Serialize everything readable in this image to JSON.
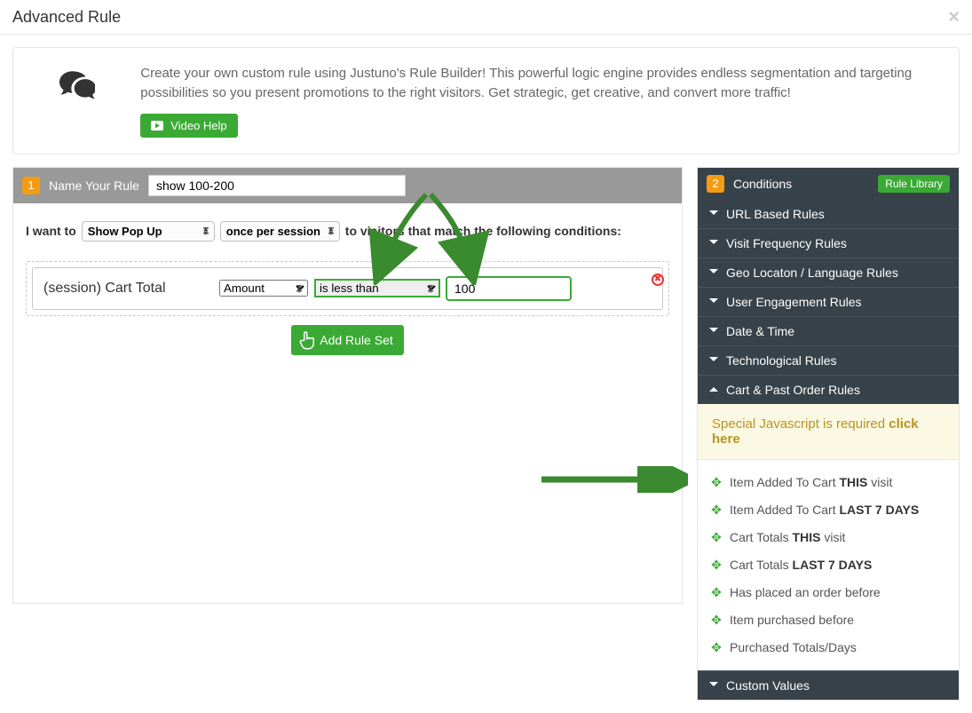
{
  "header": {
    "title": "Advanced Rule"
  },
  "intro": {
    "text": "Create your own custom rule using Justuno's Rule Builder!    This powerful logic engine provides endless segmentation and targeting possibilities so you present promotions to the right visitors. Get strategic, get creative, and convert more traffic!",
    "video_help_label": "Video Help"
  },
  "left": {
    "badge": "1",
    "name_label": "Name Your Rule",
    "name_value": "show 100-200",
    "sentence": {
      "prefix": "I want to",
      "action": "Show Pop Up",
      "frequency": "once per session",
      "suffix": "to visitors that match the following conditions:"
    },
    "rule": {
      "label": "(session) Cart Total",
      "metric": "Amount",
      "operator": "is less than",
      "value": "100"
    },
    "add_rule_label": "Add Rule Set"
  },
  "right": {
    "badge": "2",
    "title": "Conditions",
    "library_label": "Rule Library",
    "categories": [
      "URL Based Rules",
      "Visit Frequency Rules",
      "Geo Locaton / Language Rules",
      "User Engagement Rules",
      "Date & Time",
      "Technological Rules",
      "Cart & Past Order Rules"
    ],
    "expanded_warn_prefix": "Special Javascript is required ",
    "expanded_warn_link": "click here",
    "expanded_items": [
      {
        "pre": "Item Added To Cart ",
        "bold": "THIS",
        "post": " visit"
      },
      {
        "pre": "Item Added To Cart ",
        "bold": "LAST 7 DAYS",
        "post": ""
      },
      {
        "pre": "Cart Totals ",
        "bold": "THIS",
        "post": " visit"
      },
      {
        "pre": "Cart Totals ",
        "bold": "LAST 7 DAYS",
        "post": ""
      },
      {
        "pre": "Has placed an order before",
        "bold": "",
        "post": ""
      },
      {
        "pre": "Item purchased before",
        "bold": "",
        "post": ""
      },
      {
        "pre": "Purchased Totals/Days",
        "bold": "",
        "post": ""
      }
    ],
    "footer_category": "Custom Values"
  }
}
